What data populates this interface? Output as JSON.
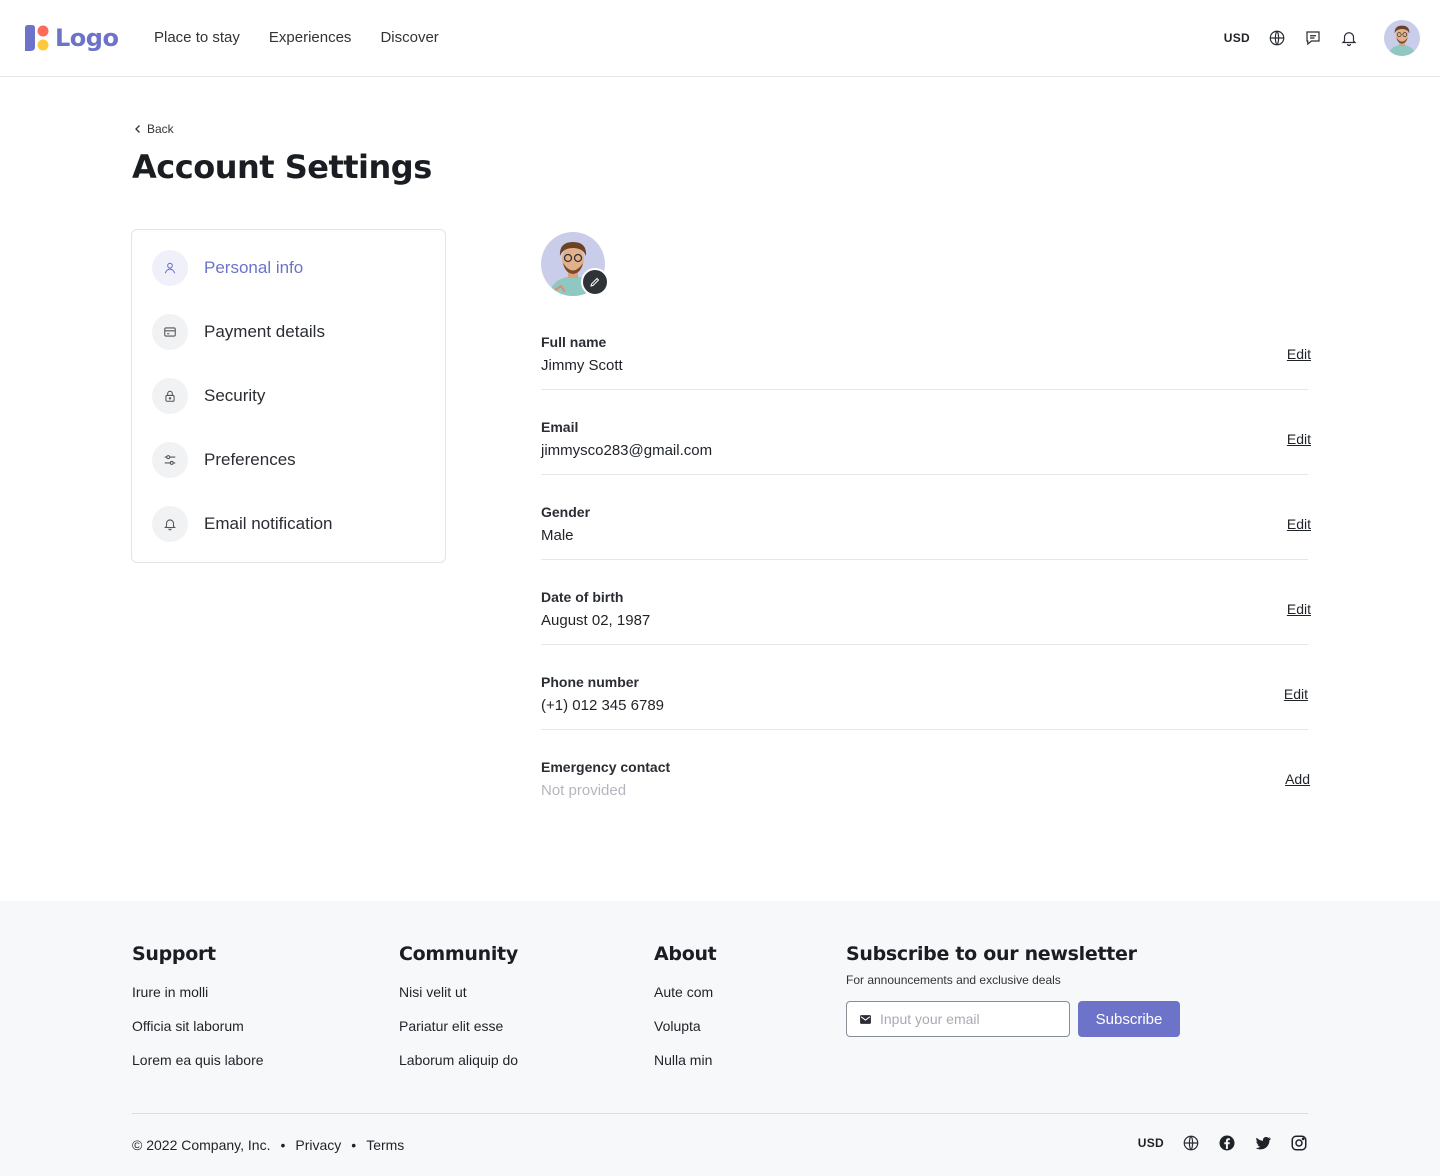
{
  "header": {
    "logo_text": "Logo",
    "nav": [
      "Place to stay",
      "Experiences",
      "Discover"
    ],
    "currency": "USD",
    "icons": [
      "globe-icon",
      "message-icon",
      "bell-icon"
    ]
  },
  "page": {
    "back_label": "Back",
    "title": "Account Settings"
  },
  "sidebar": {
    "items": [
      {
        "label": "Personal info",
        "icon": "user-icon",
        "active": true
      },
      {
        "label": "Payment details",
        "icon": "card-icon",
        "active": false
      },
      {
        "label": "Security",
        "icon": "lock-icon",
        "active": false
      },
      {
        "label": "Preferences",
        "icon": "sliders-icon",
        "active": false
      },
      {
        "label": "Email notification",
        "icon": "bell-icon",
        "active": false
      }
    ]
  },
  "profile": {
    "fields": [
      {
        "label": "Full name",
        "value": "Jimmy Scott",
        "action": "Edit"
      },
      {
        "label": "Email",
        "value": "jimmysco283@gmail.com",
        "action": "Edit"
      },
      {
        "label": "Gender",
        "value": "Male",
        "action": "Edit"
      },
      {
        "label": "Date of birth",
        "value": "August 02, 1987",
        "action": "Edit"
      },
      {
        "label": "Phone number",
        "value": "(+1) 012 345 6789",
        "action": "Edit"
      },
      {
        "label": "Emergency contact",
        "value": "Not provided",
        "action": "Add"
      }
    ]
  },
  "footer": {
    "columns": [
      {
        "title": "Support",
        "links": [
          "Irure in molli",
          "Officia sit laborum",
          "Lorem ea quis labore"
        ]
      },
      {
        "title": "Community",
        "links": [
          "Nisi velit ut",
          "Pariatur elit esse",
          "Laborum aliquip do"
        ]
      },
      {
        "title": "About",
        "links": [
          "Aute com",
          "Volupta",
          "Nulla min"
        ]
      }
    ],
    "newsletter": {
      "title": "Subscribe to our newsletter",
      "subtitle": "For announcements and exclusive deals",
      "placeholder": "Input your email",
      "button": "Subscribe"
    },
    "copyright": "© 2022 Company, Inc.",
    "bottom_links": [
      "Privacy",
      "Terms"
    ],
    "currency": "USD",
    "social_icons": [
      "globe-icon",
      "facebook-icon",
      "twitter-icon",
      "instagram-icon"
    ]
  },
  "colors": {
    "accent": "#6c73c9",
    "text": "#1f2328",
    "muted": "#b3b6bd",
    "footer_bg": "#f7f8fa"
  }
}
